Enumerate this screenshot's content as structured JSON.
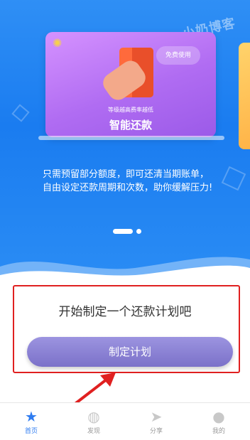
{
  "watermark": "小奶博客",
  "banner": {
    "bubble": "免费使用",
    "subtitle": "等级越高费率越低",
    "title": "智能还款"
  },
  "description": "只需预留部分额度，即可还清当期账单，自由设定还款周期和次数，助你缓解压力!",
  "plan": {
    "title": "开始制定一个还款计划吧",
    "button": "制定计划"
  },
  "tabs": [
    {
      "label": "首页",
      "icon": "star-icon",
      "active": true
    },
    {
      "label": "发现",
      "icon": "planet-icon",
      "active": false
    },
    {
      "label": "分享",
      "icon": "paper-plane-icon",
      "active": false
    },
    {
      "label": "我的",
      "icon": "user-icon",
      "active": false
    }
  ],
  "colors": {
    "hero": "#1a7cf0",
    "card": "#b06cf2",
    "button": "#8a80d4",
    "highlight": "#e02020",
    "tab_active": "#2f7cf0"
  }
}
